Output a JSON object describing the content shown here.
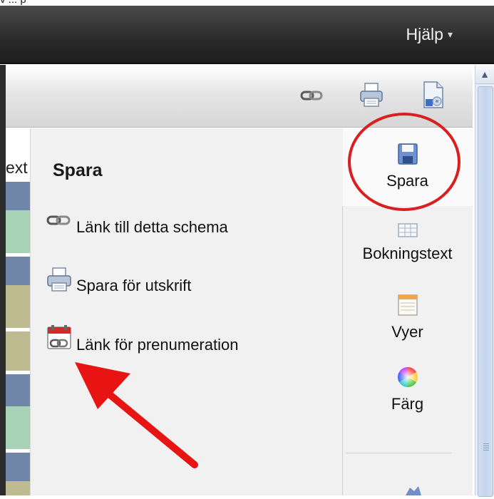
{
  "header": {
    "help_label": "Hjälp",
    "help_arrow": "▾"
  },
  "fragments": {
    "top_clipped_text": "v ... p",
    "left_clipped_text": "ext"
  },
  "toolbar": {
    "icons": [
      "link-icon",
      "print-icon",
      "export-document-icon"
    ]
  },
  "panel": {
    "title": "Spara",
    "items": [
      {
        "label": "Länk till detta schema",
        "icon": "link-icon"
      },
      {
        "label": "Spara för utskrift",
        "icon": "printer-icon"
      },
      {
        "label": "Länk för prenumeration",
        "icon": "calendar-link-icon"
      }
    ]
  },
  "side_nav": {
    "items": [
      {
        "label": "Spara",
        "icon": "floppy-disk-icon",
        "active": true
      },
      {
        "label": "Bokningstext",
        "icon": "text-grid-icon",
        "active": false
      },
      {
        "label": "Vyer",
        "icon": "calendar-view-icon",
        "active": false
      },
      {
        "label": "Färg",
        "icon": "color-wheel-icon",
        "active": false
      }
    ]
  },
  "annotations": {
    "circle_color": "#d91f1f",
    "arrow_color": "#e81414"
  },
  "colors": {
    "topbar": "#2f2f2f",
    "stripe_green": "#a9d3b6",
    "stripe_olive": "#bdbb8f",
    "stripe_blue": "#6f86a9"
  }
}
